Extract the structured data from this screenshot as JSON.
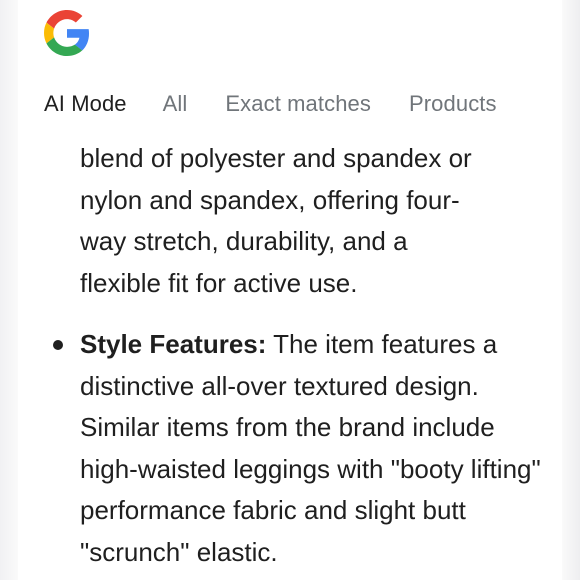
{
  "logo": {
    "icon": "google-g-icon",
    "colors": {
      "blue": "#4285F4",
      "red": "#EA4335",
      "yellow": "#FBBC05",
      "green": "#34A853"
    }
  },
  "tabs": [
    {
      "label": "AI Mode",
      "active": true
    },
    {
      "label": "All",
      "active": false
    },
    {
      "label": "Exact matches",
      "active": false
    },
    {
      "label": "Products",
      "active": false
    }
  ],
  "content": {
    "paragraph_line1": "blend of polyester and spandex or",
    "paragraph_line2": "nylon and spandex, offering four-",
    "paragraph_line3": "way stretch, durability, and a",
    "paragraph_line4": "flexible fit for active use.",
    "bullet": {
      "heading": "Style Features:",
      "text": " The item features a distinctive all-over textured design. Similar items from the brand include high-waisted leggings with \"booty lifting\" performance fabric and slight butt \"scrunch\" elastic."
    }
  }
}
